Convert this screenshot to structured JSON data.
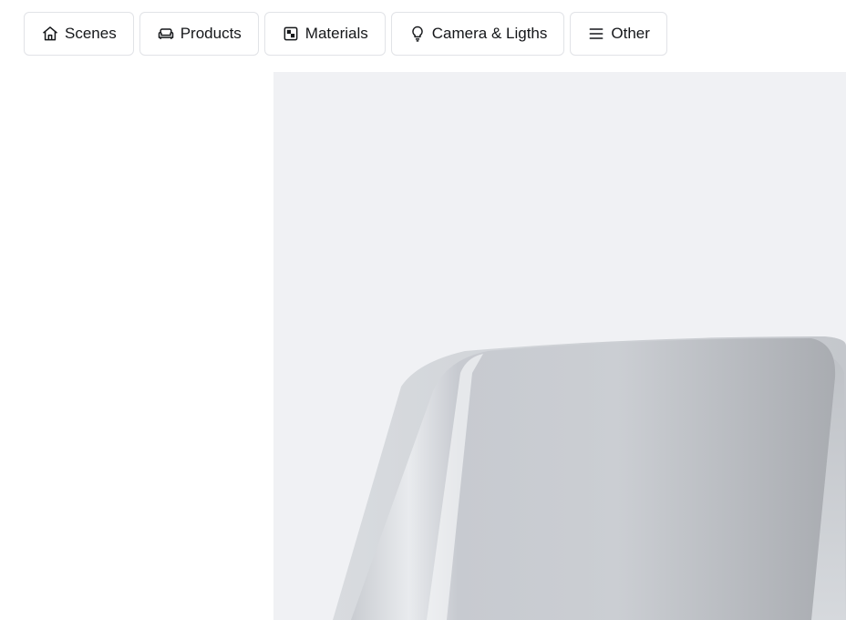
{
  "toolbar": {
    "tabs": [
      {
        "label": "Scenes",
        "icon": "home-icon"
      },
      {
        "label": "Products",
        "icon": "sofa-icon"
      },
      {
        "label": "Materials",
        "icon": "material-checker-icon"
      },
      {
        "label": "Camera & Ligths",
        "icon": "lightbulb-icon"
      },
      {
        "label": "Other",
        "icon": "menu-icon"
      }
    ]
  },
  "viewport": {
    "background": "#f0f1f4",
    "content": "3d-chair-render"
  }
}
